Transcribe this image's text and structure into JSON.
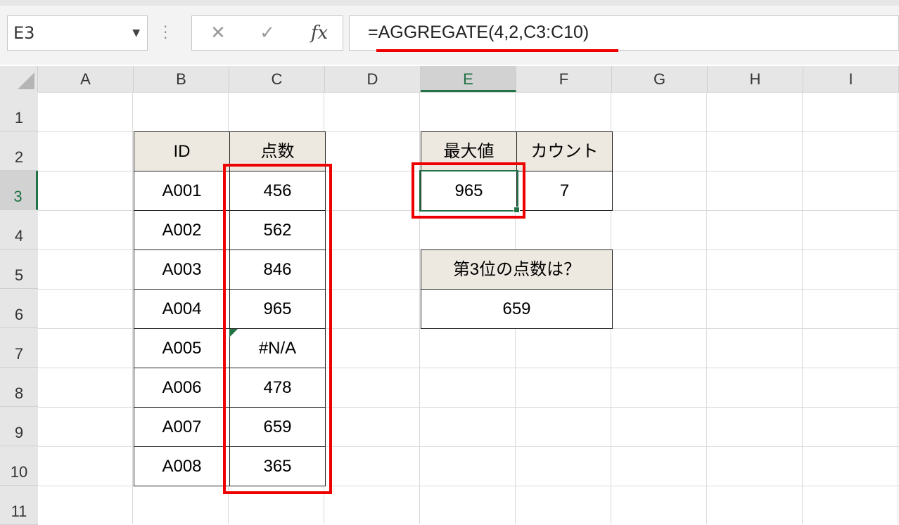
{
  "name_box": "E3",
  "formula_bar": {
    "cancel_icon": "✕",
    "enter_icon": "✓",
    "fx_label": "fx",
    "formula": "=AGGREGATE(4,2,C3:C10)"
  },
  "columns": [
    "A",
    "B",
    "C",
    "D",
    "E",
    "F",
    "G",
    "H",
    "I"
  ],
  "rows": [
    "1",
    "2",
    "3",
    "4",
    "5",
    "6",
    "7",
    "8",
    "9",
    "10",
    "11"
  ],
  "selected_cell": "E3",
  "table": {
    "headers": [
      "ID",
      "点数"
    ],
    "rows": [
      [
        "A001",
        "456"
      ],
      [
        "A002",
        "562"
      ],
      [
        "A003",
        "846"
      ],
      [
        "A004",
        "965"
      ],
      [
        "A005",
        "#N/A"
      ],
      [
        "A006",
        "478"
      ],
      [
        "A007",
        "659"
      ],
      [
        "A008",
        "365"
      ]
    ]
  },
  "summary": {
    "max_header": "最大値",
    "count_header": "カウント",
    "max_value": "965",
    "count_value": "7"
  },
  "rank3": {
    "header": "第3位の点数は？",
    "value": "659"
  },
  "colors": {
    "highlight": "#ee0000",
    "selection": "#217346",
    "header_fill": "#eee9e0"
  }
}
